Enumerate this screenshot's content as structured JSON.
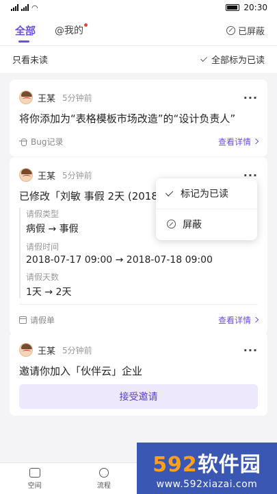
{
  "status": {
    "time": "20:30"
  },
  "tabs": [
    {
      "label": "全部",
      "active": true
    },
    {
      "label": "@我的",
      "active": false,
      "has_dot": true
    }
  ],
  "header": {
    "blocked_label": "已屏蔽"
  },
  "filter": {
    "unread_only_label": "只看未读",
    "mark_all_read_label": "全部标为已读"
  },
  "cards": [
    {
      "name": "王某",
      "time": "5分钟前",
      "title": "将你添加为“表格模板市场改造”的“设计负责人”",
      "tag": "Bug记录",
      "link": "查看详情"
    },
    {
      "name": "王某",
      "time": "5分钟前",
      "title": "已修改「刘敏 事假 2天 (2018-07",
      "details": [
        {
          "label": "请假类型",
          "value": "病假 → 事假"
        },
        {
          "label": "请假时间",
          "value": "2018-07-17 09:00 → 2018-07-18 09:00"
        },
        {
          "label": "请假天数",
          "value": "1天 → 2天"
        }
      ],
      "tag": "请假单",
      "link": "查看详情"
    },
    {
      "name": "王某",
      "time": "5分钟前",
      "title": "邀请你加入「伙伴云」企业",
      "button": "接受邀请"
    }
  ],
  "popover": {
    "items": [
      "标记为已读",
      "屏蔽"
    ]
  },
  "bottom_nav": [
    {
      "label": "空间",
      "icon": "space-icon"
    },
    {
      "label": "流程",
      "icon": "flow-icon"
    }
  ],
  "watermark": {
    "brand_num": "592",
    "brand_text": "软件园",
    "url": "www.592xiazai.com"
  }
}
